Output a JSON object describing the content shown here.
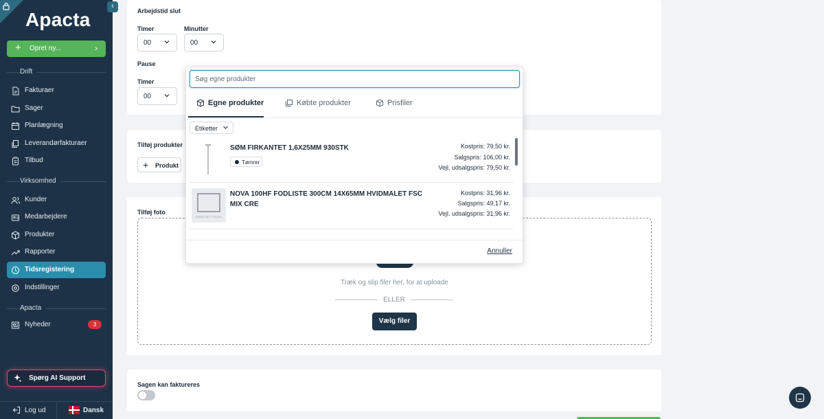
{
  "brand": {
    "logo": "Apacta"
  },
  "sidebar": {
    "create_label": "Opret ny...",
    "sections": {
      "drift": "Drift",
      "virksomhed": "Virksomhed",
      "apacta": "Apacta"
    },
    "items": [
      {
        "label": "Fakturaer",
        "icon": "invoice-icon"
      },
      {
        "label": "Sager",
        "icon": "folder-icon"
      },
      {
        "label": "Planlægning",
        "icon": "calendar-icon"
      },
      {
        "label": "Leverandørfakturaer",
        "icon": "copy-icon"
      },
      {
        "label": "Tilbud",
        "icon": "clipboard-icon"
      },
      {
        "label": "Kunder",
        "icon": "users-icon"
      },
      {
        "label": "Medarbejdere",
        "icon": "employee-icon"
      },
      {
        "label": "Produkter",
        "icon": "box-icon"
      },
      {
        "label": "Rapporter",
        "icon": "trend-icon"
      },
      {
        "label": "Tidsregistering",
        "icon": "clock-icon",
        "active": true
      },
      {
        "label": "Indstillinger",
        "icon": "gear-icon"
      },
      {
        "label": "Nyheder",
        "icon": "news-icon",
        "badge": "3"
      }
    ],
    "ai_support": "Spørg AI Support",
    "logout": "Log ud",
    "language": "Dansk"
  },
  "form": {
    "end_time_label": "Arbejdstid slut",
    "hours_label": "Timer",
    "minutes_label": "Minutter",
    "hours_value": "00",
    "minutes_value": "00",
    "pause_label": "Pause",
    "pause_hours_label": "Timer",
    "pause_hours_value": "00",
    "add_products_label": "Tilføj produkter",
    "product_button": "Produkt",
    "add_photo_label": "Tilføj foto",
    "drop_text": "Træk og slip filer her, for at uploade",
    "or_text": "ELLER",
    "choose_files": "Vælg filer",
    "billable_label": "Sagen kan faktureres",
    "billable": false
  },
  "popover": {
    "search_placeholder": "Søg egne produkter",
    "tabs": [
      {
        "label": "Egne produkter",
        "active": true
      },
      {
        "label": "Købte produkter"
      },
      {
        "label": "Prisfiler"
      }
    ],
    "tags_filter": "Etiketter",
    "products": [
      {
        "name": "SØM FIRKANTET 1,6X25MM 930STK",
        "tag": "Tømrer",
        "cost": "Kostpris: 79,50 kr.",
        "sale": "Salgspris: 106,00 kr.",
        "retail": "Vejl. udsalgspris: 79,50 kr."
      },
      {
        "name": "NOVA 100HF FODLISTE 300CM 14X65MM HVIDMALET FSC MIX CRE",
        "image_text": "IMAGE NOT FOUND",
        "cost": "Kostpris: 31,96 kr.",
        "sale": "Salgspris: 49,17 kr.",
        "retail": "Vejl. udsalgspris: 31,96 kr."
      }
    ],
    "cancel": "Annuller"
  },
  "colors": {
    "sidebar": "#1d3246",
    "accent": "#2a8dab",
    "green": "#56b45a",
    "dark_button": "#1f3548"
  }
}
